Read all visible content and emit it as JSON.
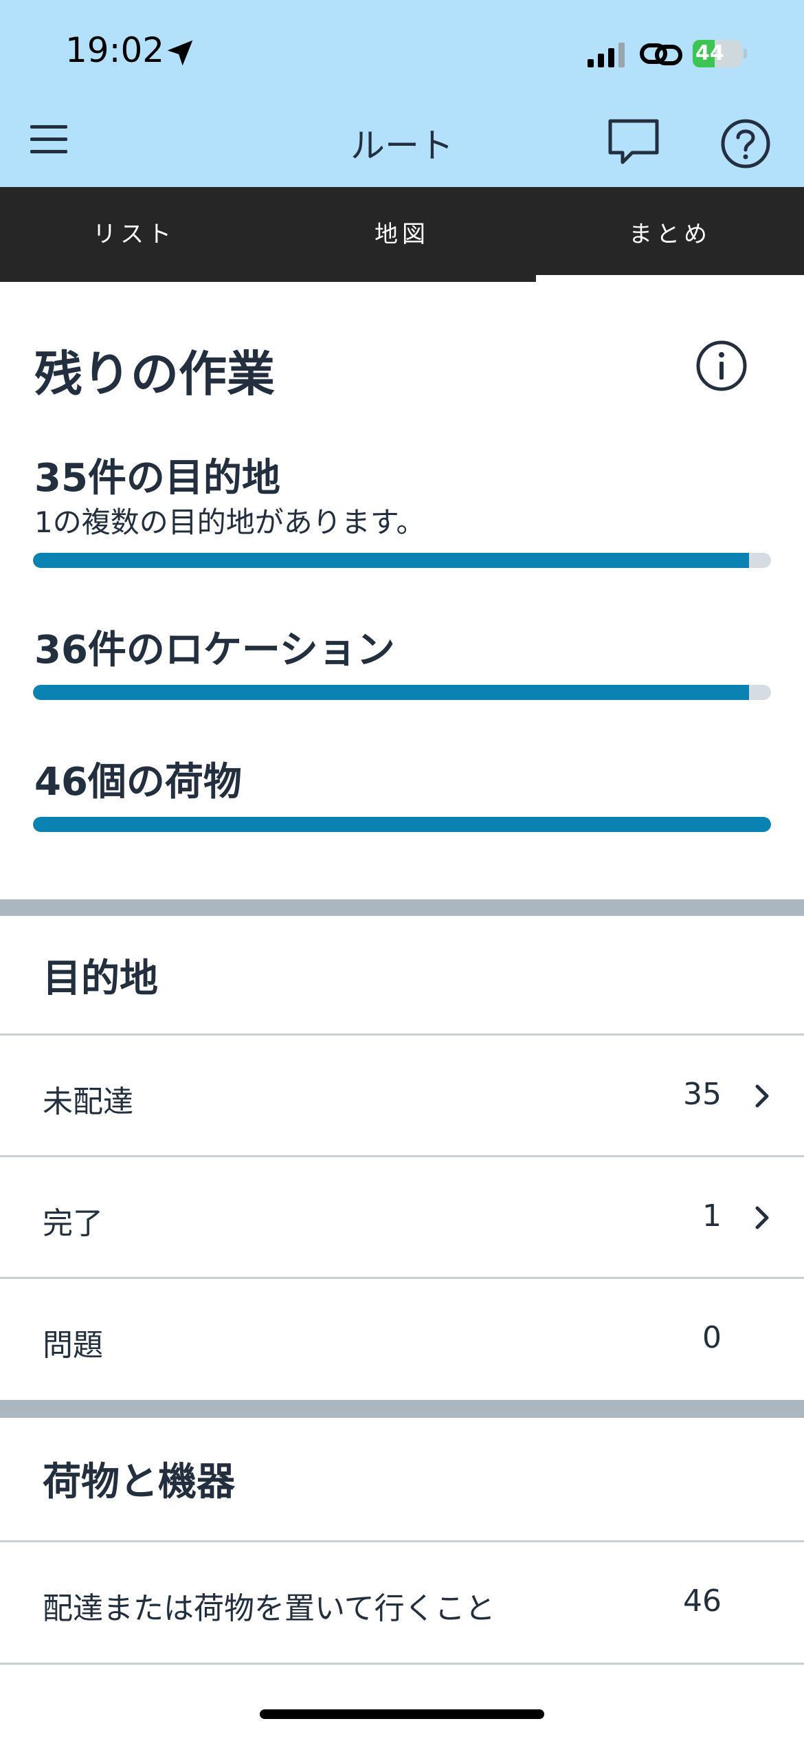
{
  "status_bar": {
    "time": "19:02",
    "battery": "44",
    "battery_level": 0.44,
    "icons": [
      "location-arrow-icon",
      "signal-icon",
      "link-icon",
      "battery-charging-icon"
    ]
  },
  "header": {
    "title": "ルート",
    "icons": [
      "menu-icon",
      "chat-icon",
      "help-icon"
    ]
  },
  "tabs": [
    {
      "label": "リスト"
    },
    {
      "label": "地図"
    },
    {
      "label": "まとめ"
    }
  ],
  "summary": {
    "title": "残りの作業",
    "metrics": [
      {
        "label": "35件の目的地",
        "sub": "1の複数の目的地があります。",
        "progress": 0.97
      },
      {
        "label": "36件のロケーション",
        "progress": 0.97
      },
      {
        "label": "46個の荷物",
        "progress": 1.0
      }
    ]
  },
  "destinations": {
    "title": "目的地",
    "rows": [
      {
        "label": "未配達",
        "value": "35"
      },
      {
        "label": "完了",
        "value": "1"
      },
      {
        "label": "問題",
        "value": "0"
      }
    ]
  },
  "packages": {
    "title": "荷物と機器",
    "rows": [
      {
        "label": "配達または荷物を置いて行くこと",
        "value": "46"
      }
    ]
  },
  "colors": {
    "header_bg": "#b3e0fb",
    "tab_bg": "#262626",
    "progress": "#0a82b2",
    "text": "#232f3e"
  }
}
